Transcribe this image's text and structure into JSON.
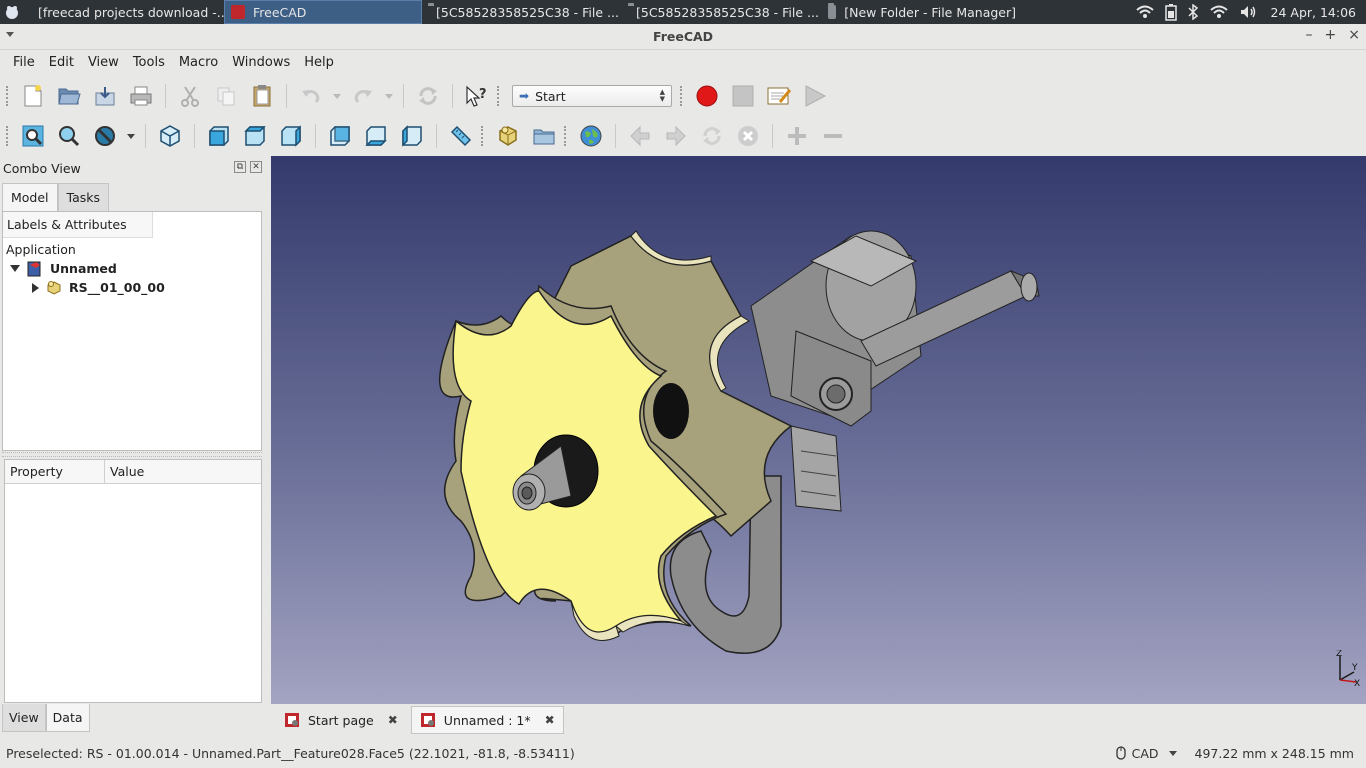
{
  "taskbar": {
    "tasks": [
      {
        "label": "[freecad projects download -..."
      },
      {
        "label": "FreeCAD"
      },
      {
        "label": "[5C58528358525C38 - File ..."
      },
      {
        "label": "[5C58528358525C38 - File ..."
      },
      {
        "label": "[New Folder - File Manager]"
      }
    ],
    "clock": "24 Apr, 14:06"
  },
  "window": {
    "title": "FreeCAD"
  },
  "menu": [
    "File",
    "Edit",
    "View",
    "Tools",
    "Macro",
    "Windows",
    "Help"
  ],
  "toolbar": {
    "workbench": "Start"
  },
  "combo_view": {
    "title": "Combo View",
    "tabs": [
      "Model",
      "Tasks"
    ],
    "tree_header": "Labels & Attributes",
    "tree": {
      "root": "Application",
      "document": "Unnamed",
      "object": "RS__01_00_00"
    },
    "property_headers": [
      "Property",
      "Value"
    ],
    "bottom_tabs": [
      "View",
      "Data"
    ]
  },
  "doc_tabs": [
    {
      "label": "Start page"
    },
    {
      "label": "Unnamed : 1*"
    }
  ],
  "axes": {
    "z": "Z",
    "y": "Y",
    "x": "X"
  },
  "status": {
    "message": "Preselected: RS - 01.00.014 - Unnamed.Part__Feature028.Face5 (22.1021, -81.8, -8.53411)",
    "nav_style": "CAD",
    "dimensions": "497.22 mm x 248.15 mm"
  },
  "colors": {
    "selected_face": "#fbf58e",
    "gear_tan": "#a8a27c",
    "metal_gray": "#9a9a9a",
    "bg_top": "#343a6c",
    "bg_bottom": "#a3a3c2",
    "record_red": "#e01818"
  }
}
